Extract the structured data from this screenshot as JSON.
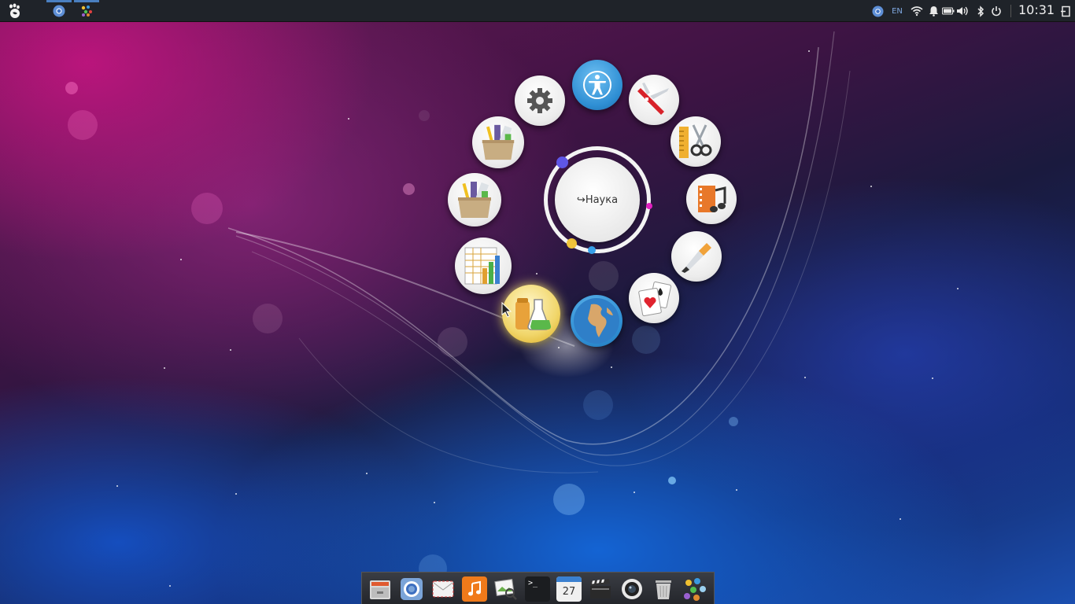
{
  "topbar": {
    "clock": "10:31",
    "language": "EN",
    "tasks": [
      "chromium-icon",
      "colorful-dots-icon"
    ]
  },
  "menu": {
    "center_label": "↪Наука",
    "items": [
      {
        "name": "accessibility",
        "icon": "accessibility-icon"
      },
      {
        "name": "utilities",
        "icon": "swiss-knife-icon"
      },
      {
        "name": "graphics",
        "icon": "scissors-ruler-icon"
      },
      {
        "name": "multimedia",
        "icon": "film-music-icon"
      },
      {
        "name": "painting",
        "icon": "paint-brush-icon"
      },
      {
        "name": "games",
        "icon": "playing-cards-icon"
      },
      {
        "name": "internet",
        "icon": "globe-icon"
      },
      {
        "name": "science",
        "icon": "lab-flask-icon",
        "active": true
      },
      {
        "name": "office",
        "icon": "spreadsheet-chart-icon"
      },
      {
        "name": "education-1",
        "icon": "supplies-box-icon"
      },
      {
        "name": "education-2",
        "icon": "supplies-box-icon"
      },
      {
        "name": "settings",
        "icon": "gear-icon"
      }
    ]
  },
  "dock": {
    "calendar_day": "27",
    "terminal_prompt": ">_",
    "items": [
      "file-manager-icon",
      "chromium-icon",
      "mail-icon",
      "music-icon",
      "image-viewer-icon",
      "terminal-icon",
      "calendar-icon",
      "video-editor-icon",
      "webcam-icon",
      "trash-icon",
      "app-launcher-icon"
    ]
  },
  "colors": {
    "panel": "#1f2329",
    "accent_blue": "#4a7fc0",
    "active_glow": "#f1d66a"
  }
}
